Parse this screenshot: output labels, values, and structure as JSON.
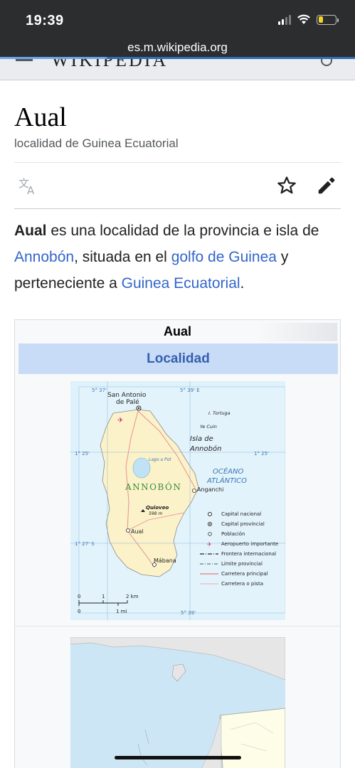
{
  "status_bar": {
    "time": "19:39"
  },
  "browser": {
    "url": "es.m.wikipedia.org"
  },
  "header": {
    "logo": "WIKIPEDIA"
  },
  "article": {
    "title": "Aual",
    "description": "localidad de Guinea Ecuatorial",
    "lead": {
      "bold": "Aual",
      "t1": " es una localidad de la provincia e isla de ",
      "link1": "Annobón",
      "t2": ", situada en el ",
      "link2": "golfo de Guinea",
      "t3": " y perteneciente a ",
      "link3": "Guinea Ecuatorial",
      "t4": "."
    }
  },
  "infobox": {
    "title": "Aual",
    "band": "Localidad",
    "map": {
      "coords": {
        "top_left": "5° 37'",
        "top_right": "5° 39' E",
        "left1": "1° 25'",
        "right1": "1° 25'",
        "left2": "1° 27' S",
        "bottom": "5° 39'"
      },
      "places": {
        "san_antonio_1": "San Antonio",
        "san_antonio_2": "de Palé",
        "tortuga": "I. Tortuga",
        "yecuin": "Ye Cuin",
        "isla_1": "Isla de",
        "isla_2": "Annobón",
        "lago": "Lago a Pot",
        "oceano_1": "OCÉANO",
        "oceano_2": "ATLÁNTICO",
        "annobon": "ANNOBÓN",
        "anganchi": "Anganchi",
        "quioveo": "Quioveo",
        "quioveo_alt": "598 m",
        "aual": "Aual",
        "mabana": "Mábana"
      },
      "legend": [
        "Capital nacional",
        "Capital provincial",
        "Población",
        "Aeropuerto importante",
        "Frontera internacional",
        "Límite provincial",
        "Carretera principal",
        "Carretera o pista"
      ],
      "scale": {
        "t0": "0",
        "t1": "1",
        "t2": "2 km",
        "b0": "0",
        "b1": "1 mi"
      }
    }
  }
}
